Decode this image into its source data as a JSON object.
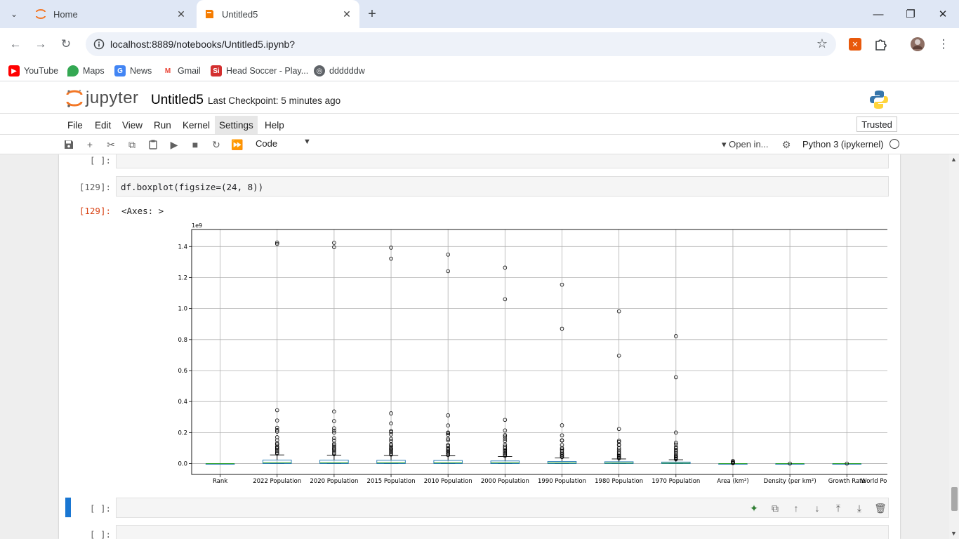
{
  "browser": {
    "tabs": [
      {
        "title": "Home",
        "icon": "jupyter-icon"
      },
      {
        "title": "Untitled5",
        "icon": "notebook-icon"
      }
    ],
    "url": "localhost:8889/notebooks/Untitled5.ipynb?",
    "bookmarks": [
      {
        "label": "YouTube",
        "icon": "youtube-icon"
      },
      {
        "label": "Maps",
        "icon": "maps-icon"
      },
      {
        "label": "News",
        "icon": "news-icon"
      },
      {
        "label": "Gmail",
        "icon": "gmail-icon"
      },
      {
        "label": "Head Soccer - Play...",
        "icon": "si-icon"
      },
      {
        "label": "ddddddw",
        "icon": "globe-icon"
      }
    ]
  },
  "jupyter": {
    "logo_text": "jupyter",
    "notebook_title": "Untitled5",
    "checkpoint": "Last Checkpoint: 5 minutes ago",
    "menus": [
      "File",
      "Edit",
      "View",
      "Run",
      "Kernel",
      "Settings",
      "Help"
    ],
    "trusted": "Trusted",
    "cell_type": "Code",
    "open_in": "Open in...",
    "kernel": "Python 3 (ipykernel)"
  },
  "cells": {
    "empty_prompt_top": "[ ]:",
    "code_prompt": "[129]:",
    "code": "df.boxplot(figsize=(24, 8))",
    "out_prompt": "[129]:",
    "out_text": "<Axes: >",
    "active_prompt": "[ ]:",
    "bottom_prompt": "[ ]:"
  },
  "chart_data": {
    "type": "box",
    "title": "",
    "xlabel": "",
    "ylabel": "",
    "offset_label": "1e9",
    "ylim": [
      -0.07,
      1.51
    ],
    "yticks": [
      0.0,
      0.2,
      0.4,
      0.6,
      0.8,
      1.0,
      1.2,
      1.4
    ],
    "ytick_labels": [
      "0.0",
      "0.2",
      "0.4",
      "0.6",
      "0.8",
      "1.0",
      "1.2",
      "1.4"
    ],
    "grid": true,
    "categories": [
      "Rank",
      "2022 Population",
      "2020 Population",
      "2015 Population",
      "2010 Population",
      "2000 Population",
      "1990 Population",
      "1980 Population",
      "1970 Population",
      "Area (km²)",
      "Density (per km²)",
      "Growth Rate",
      "World Population Percentage"
    ],
    "boxes": [
      {
        "q1": 0.0,
        "median": 0.0,
        "q3": 0.0,
        "whisker_low": 0.0,
        "whisker_high": 0.0,
        "outliers": []
      },
      {
        "q1": 0.0004,
        "median": 0.0056,
        "q3": 0.023,
        "whisker_low": 0.0,
        "whisker_high": 0.056,
        "outliers": [
          1.426,
          1.417,
          0.344,
          0.278,
          0.231,
          0.216,
          0.206,
          0.17,
          0.15,
          0.13,
          0.124,
          0.11,
          0.104,
          0.098,
          0.09,
          0.08,
          0.07,
          0.064
        ]
      },
      {
        "q1": 0.0004,
        "median": 0.0055,
        "q3": 0.022,
        "whisker_low": 0.0,
        "whisker_high": 0.054,
        "outliers": [
          1.424,
          1.396,
          0.336,
          0.274,
          0.228,
          0.213,
          0.2,
          0.164,
          0.148,
          0.128,
          0.12,
          0.11,
          0.1,
          0.095,
          0.088,
          0.078,
          0.068,
          0.06
        ]
      },
      {
        "q1": 0.0004,
        "median": 0.0053,
        "q3": 0.021,
        "whisker_low": 0.0,
        "whisker_high": 0.052,
        "outliers": [
          1.393,
          1.322,
          0.324,
          0.259,
          0.21,
          0.204,
          0.188,
          0.16,
          0.145,
          0.125,
          0.117,
          0.105,
          0.1,
          0.092,
          0.084,
          0.075,
          0.066,
          0.058
        ]
      },
      {
        "q1": 0.0004,
        "median": 0.005,
        "q3": 0.02,
        "whisker_low": 0.0,
        "whisker_high": 0.05,
        "outliers": [
          1.348,
          1.241,
          0.311,
          0.246,
          0.2,
          0.196,
          0.186,
          0.16,
          0.15,
          0.12,
          0.114,
          0.1,
          0.095,
          0.086,
          0.078,
          0.07,
          0.062,
          0.055
        ]
      },
      {
        "q1": 0.0003,
        "median": 0.0045,
        "q3": 0.017,
        "whisker_low": 0.0,
        "whisker_high": 0.045,
        "outliers": [
          1.264,
          1.06,
          0.282,
          0.214,
          0.184,
          0.174,
          0.16,
          0.145,
          0.122,
          0.11,
          0.1,
          0.09,
          0.082,
          0.075,
          0.066,
          0.058,
          0.05
        ]
      },
      {
        "q1": 0.0003,
        "median": 0.004,
        "q3": 0.014,
        "whisker_low": 0.0,
        "whisker_high": 0.036,
        "outliers": [
          1.154,
          0.87,
          0.247,
          0.182,
          0.15,
          0.148,
          0.12,
          0.1,
          0.092,
          0.082,
          0.07,
          0.062,
          0.055,
          0.048,
          0.042
        ]
      },
      {
        "q1": 0.0002,
        "median": 0.0035,
        "q3": 0.012,
        "whisker_low": 0.0,
        "whisker_high": 0.03,
        "outliers": [
          0.982,
          0.696,
          0.223,
          0.147,
          0.14,
          0.122,
          0.119,
          0.1,
          0.09,
          0.078,
          0.068,
          0.058,
          0.05,
          0.044,
          0.038,
          0.034
        ]
      },
      {
        "q1": 0.0002,
        "median": 0.003,
        "q3": 0.01,
        "whisker_low": 0.0,
        "whisker_high": 0.025,
        "outliers": [
          0.822,
          0.557,
          0.2,
          0.135,
          0.123,
          0.105,
          0.1,
          0.088,
          0.08,
          0.07,
          0.06,
          0.052,
          0.045,
          0.038,
          0.032,
          0.028
        ]
      },
      {
        "q1": 0.0,
        "median": 0.0,
        "q3": 0.0,
        "whisker_low": 0.0,
        "whisker_high": 0.0,
        "outliers": [
          0.017,
          0.0098,
          0.0084,
          0.0063,
          0.0058,
          0.004,
          0.003
        ]
      },
      {
        "q1": 0.0,
        "median": 0.0,
        "q3": 0.0,
        "whisker_low": 0.0,
        "whisker_high": 0.0,
        "outliers": [
          0.0
        ]
      },
      {
        "q1": 0.0,
        "median": 0.0,
        "q3": 0.0,
        "whisker_low": 0.0,
        "whisker_high": 0.0,
        "outliers": [
          0.0
        ]
      },
      {
        "q1": 0.0,
        "median": 0.0,
        "q3": 0.0,
        "whisker_low": 0.0,
        "whisker_high": 0.0,
        "outliers": [
          0.0
        ]
      }
    ],
    "colors": {
      "box": "#1f77b4",
      "median": "#2ca02c",
      "whisker": "#000000",
      "grid": "#b0b0b0"
    }
  }
}
